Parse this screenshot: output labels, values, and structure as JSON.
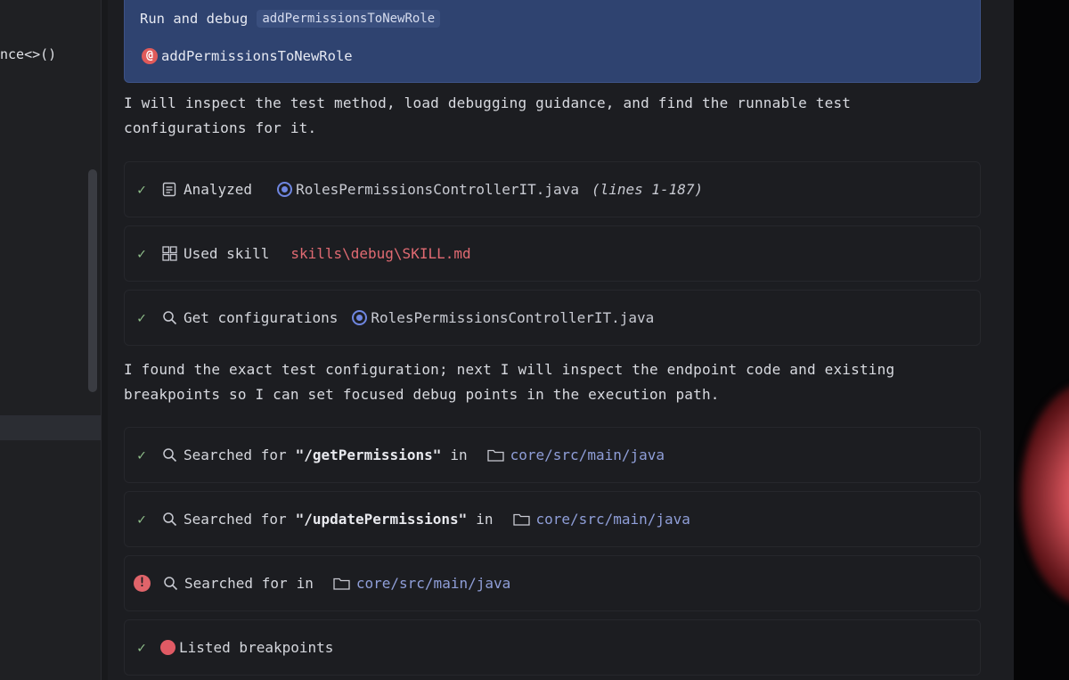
{
  "editor": {
    "code_fragment": "nce<>()"
  },
  "user_message": {
    "text": "Run and debug",
    "chip": "addPermissionsToNewRole",
    "mention": "addPermissionsToNewRole"
  },
  "paragraphs": [
    "I will inspect the test method, load debugging guidance, and find the runnable test configurations for it.",
    "I found the exact test configuration; next I will inspect the endpoint code and existing breakpoints so I can set focused debug points in the execution path."
  ],
  "steps": [
    {
      "status": "done",
      "icon": "document-icon",
      "label": "Analyzed",
      "file": "RolesPermissionsControllerIT.java",
      "detail": "(lines 1-187)"
    },
    {
      "status": "done",
      "icon": "grid-icon",
      "label": "Used skill",
      "link": "skills\\debug\\SKILL.md"
    },
    {
      "status": "done",
      "icon": "search-icon",
      "label": "Get configurations",
      "file": "RolesPermissionsControllerIT.java"
    },
    {
      "status": "done",
      "icon": "search-icon",
      "label": "Searched for",
      "query": "\"/getPermissions\"",
      "in": "in",
      "path": "core/src/main/java"
    },
    {
      "status": "done",
      "icon": "search-icon",
      "label": "Searched for",
      "query": "\"/updatePermissions\"",
      "in": "in",
      "path": "core/src/main/java"
    },
    {
      "status": "error",
      "icon": "search-icon",
      "label": "Searched for",
      "in": "in",
      "path": "core/src/main/java"
    },
    {
      "status": "done",
      "icon": "breakpoint-icon",
      "label": "Listed breakpoints"
    }
  ],
  "colors": {
    "user_bubble": "#2f4370",
    "success": "#8fbf8a",
    "error": "#e0646a",
    "link": "#8f9ed8",
    "skill_link": "#e06a72"
  }
}
